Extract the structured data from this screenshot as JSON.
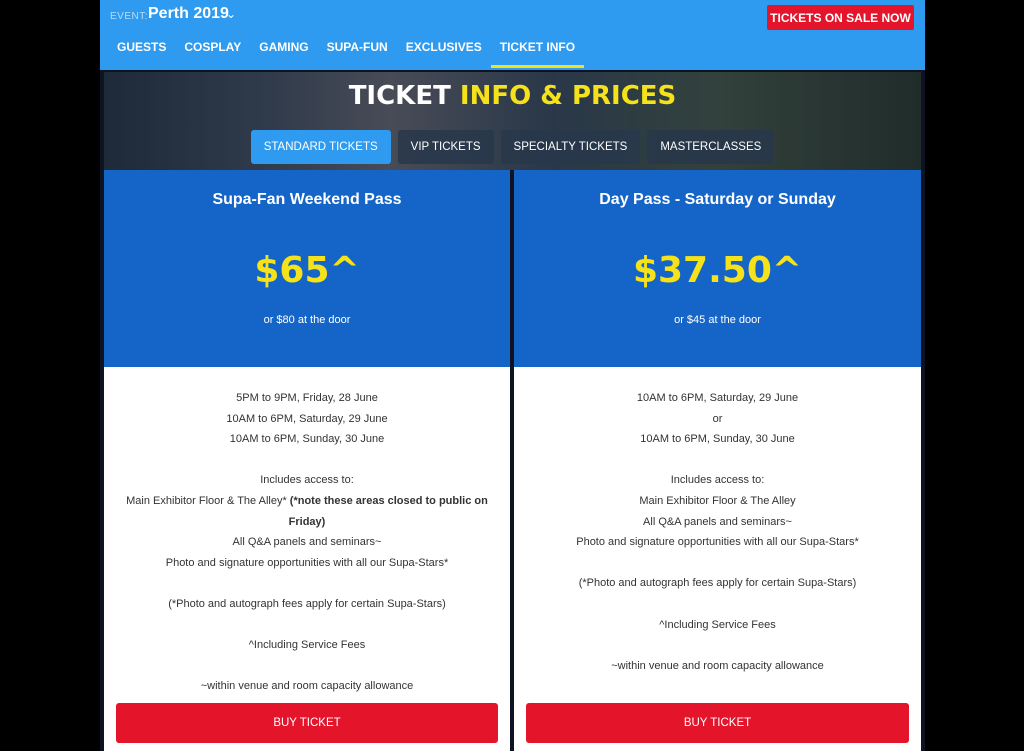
{
  "header": {
    "event_label": "EVENT:",
    "event_name": "Perth 2019",
    "sale_button": "TICKETS ON SALE NOW",
    "nav": [
      "GUESTS",
      "COSPLAY",
      "GAMING",
      "SUPA-FUN",
      "EXCLUSIVES",
      "TICKET INFO"
    ]
  },
  "hero": {
    "title_white": "TICKET",
    "title_yellow": "INFO & PRICES",
    "tabs": [
      "STANDARD TICKETS",
      "VIP TICKETS",
      "SPECIALTY TICKETS",
      "MASTERCLASSES"
    ]
  },
  "cards": [
    {
      "title": "Supa-Fan Weekend Pass",
      "price": "$65^",
      "door": "or $80 at the door",
      "lines": [
        "5PM to 9PM, Friday, 28 June",
        "10AM to 6PM, Saturday, 29 June",
        "10AM to 6PM, Sunday, 30 June",
        "",
        "Includes access to:",
        "Main Exhibitor Floor & The Alley*",
        "(*note these areas closed to public on Friday)",
        "All Q&A panels and seminars~",
        "Photo and signature opportunities with all our Supa-Stars*",
        "",
        "(*Photo and autograph fees apply for certain Supa-Stars)",
        "",
        "^Including Service Fees",
        "",
        "~within venue and room capacity allowance"
      ],
      "buy": "BUY TICKET"
    },
    {
      "title": "Day Pass - Saturday or Sunday",
      "price": "$37.50^",
      "door": "or $45 at the door",
      "lines": [
        "10AM to 6PM, Saturday, 29 June",
        "or",
        "10AM to 6PM, Sunday, 30 June",
        "",
        "Includes access to:",
        "Main Exhibitor Floor & The Alley",
        "All Q&A panels and seminars~",
        "Photo and signature opportunities with all our Supa-Stars*",
        "",
        "(*Photo and autograph fees apply for certain Supa-Stars)",
        "",
        "^Including Service Fees",
        "",
        "~within venue and room capacity allowance"
      ],
      "buy": "BUY TICKET"
    }
  ]
}
